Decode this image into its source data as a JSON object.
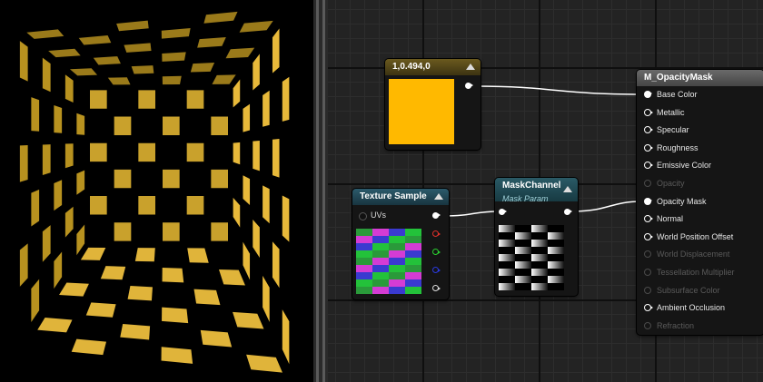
{
  "preview": {
    "object_color": "#e8b93a"
  },
  "graph": {
    "constant_node": {
      "title": "1,0.494,0",
      "color": "#ffb900"
    },
    "texture_node": {
      "title": "Texture Sample",
      "input_label": "UVs"
    },
    "mask_node": {
      "title": "MaskChannel",
      "subtitle": "Mask Param"
    },
    "material_node": {
      "title": "M_OpacityMask",
      "inputs": [
        {
          "label": "Base Color",
          "state": "connected"
        },
        {
          "label": "Metallic",
          "state": "enabled"
        },
        {
          "label": "Specular",
          "state": "enabled"
        },
        {
          "label": "Roughness",
          "state": "enabled"
        },
        {
          "label": "Emissive Color",
          "state": "enabled"
        },
        {
          "label": "Opacity",
          "state": "disabled"
        },
        {
          "label": "Opacity Mask",
          "state": "connected"
        },
        {
          "label": "Normal",
          "state": "enabled"
        },
        {
          "label": "World Position Offset",
          "state": "enabled"
        },
        {
          "label": "World Displacement",
          "state": "disabled"
        },
        {
          "label": "Tessellation Multiplier",
          "state": "disabled"
        },
        {
          "label": "Subsurface Color",
          "state": "disabled"
        },
        {
          "label": "Ambient Occlusion",
          "state": "enabled"
        },
        {
          "label": "Refraction",
          "state": "disabled"
        }
      ]
    }
  }
}
